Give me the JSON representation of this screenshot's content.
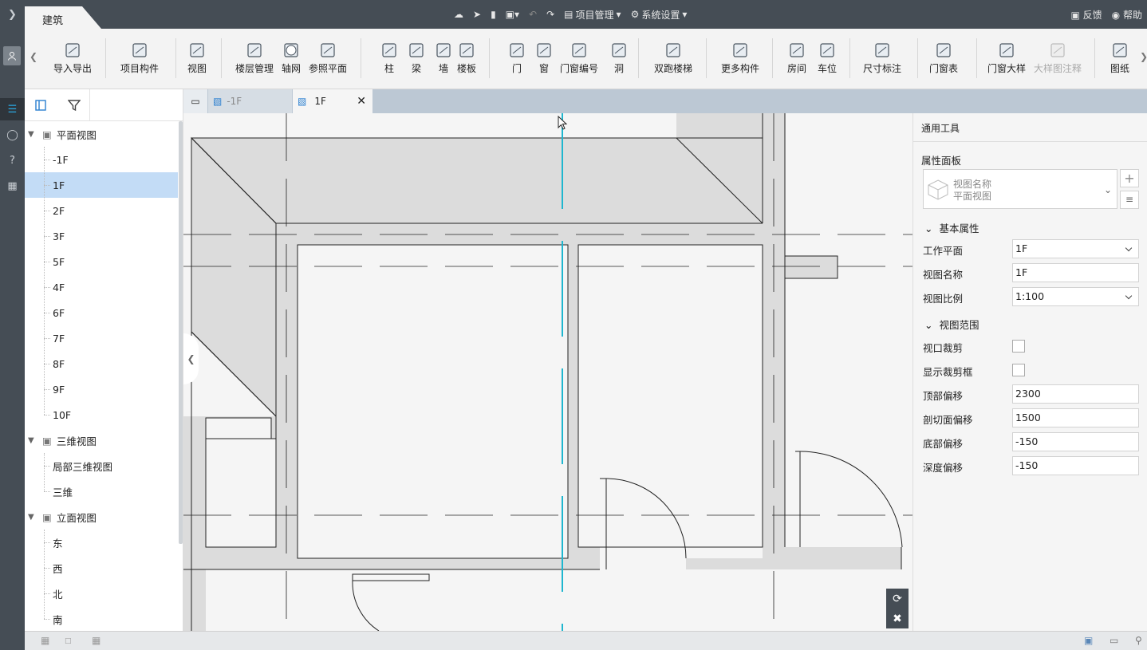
{
  "title_bar": {
    "module_tab": "建筑",
    "center": {
      "project_label": "项目管理",
      "settings_label": "系统设置"
    },
    "feedback": "反馈",
    "help": "帮助"
  },
  "toolbar": {
    "items": [
      {
        "label": "导入导出",
        "icon": "cad-import-icon"
      },
      {
        "label": "项目构件",
        "icon": "component-icon"
      },
      {
        "label": "视图",
        "icon": "view-icon"
      },
      {
        "label": "楼层管理",
        "icon": "floor-manage-icon"
      },
      {
        "label": "轴网",
        "icon": "axis-grid-icon"
      },
      {
        "label": "参照平面",
        "icon": "ref-plane-icon"
      },
      {
        "label": "柱",
        "icon": "column-icon"
      },
      {
        "label": "梁",
        "icon": "beam-icon"
      },
      {
        "label": "墙",
        "icon": "wall-icon"
      },
      {
        "label": "楼板",
        "icon": "slab-icon"
      },
      {
        "label": "门",
        "icon": "door-icon"
      },
      {
        "label": "窗",
        "icon": "window-icon"
      },
      {
        "label": "门窗编号",
        "icon": "door-window-number-icon"
      },
      {
        "label": "洞",
        "icon": "opening-icon"
      },
      {
        "label": "双跑楼梯",
        "icon": "stair-icon"
      },
      {
        "label": "更多构件",
        "icon": "more-components-icon"
      },
      {
        "label": "房间",
        "icon": "room-icon"
      },
      {
        "label": "车位",
        "icon": "parking-icon"
      },
      {
        "label": "尺寸标注",
        "icon": "dimension-icon"
      },
      {
        "label": "门窗表",
        "icon": "door-window-table-icon"
      },
      {
        "label": "门窗大样",
        "icon": "door-window-detail-icon"
      },
      {
        "label": "大样图注释",
        "icon": "detail-annotation-icon",
        "disabled": true
      },
      {
        "label": "图纸",
        "icon": "drawing-icon"
      }
    ]
  },
  "tree": {
    "plan": {
      "label": "平面视图",
      "items": [
        "-1F",
        "1F",
        "2F",
        "3F",
        "5F",
        "4F",
        "6F",
        "7F",
        "8F",
        "9F",
        "10F"
      ],
      "selected": "1F"
    },
    "three_d": {
      "label": "三维视图",
      "items": [
        "局部三维视图",
        "三维"
      ]
    },
    "elevation": {
      "label": "立面视图",
      "items": [
        "东",
        "西",
        "北",
        "南"
      ]
    }
  },
  "doc_tabs": [
    {
      "label": "-1F",
      "active": false
    },
    {
      "label": "1F",
      "active": true
    }
  ],
  "panel": {
    "common_tools": "通用工具",
    "properties_title": "属性面板",
    "view_type": {
      "name_label": "视图名称",
      "value": "平面视图"
    },
    "basic_section": "基本属性",
    "work_plane": {
      "label": "工作平面",
      "value": "1F"
    },
    "view_name": {
      "label": "视图名称",
      "value": "1F"
    },
    "view_scale": {
      "label": "视图比例",
      "value": "1:100"
    },
    "range_section": "视图范围",
    "viewport_crop": {
      "label": "视口裁剪",
      "checked": false
    },
    "show_crop": {
      "label": "显示裁剪框",
      "checked": false
    },
    "top_offset": {
      "label": "顶部偏移",
      "value": "2300"
    },
    "cut_offset": {
      "label": "剖切面偏移",
      "value": "1500"
    },
    "bottom_offset": {
      "label": "底部偏移",
      "value": "-150"
    },
    "depth_offset": {
      "label": "深度偏移",
      "value": "-150"
    }
  },
  "colors": {
    "rail": "#454d55",
    "accent": "#1fb6cf",
    "selected": "#c3dcf6"
  }
}
